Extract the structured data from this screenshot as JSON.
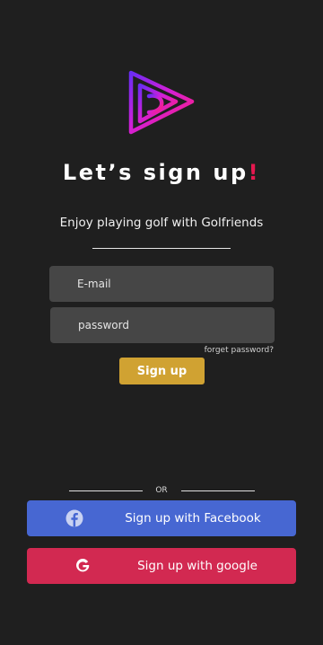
{
  "header": {
    "title": "Let’s sign up",
    "title_accent": "!",
    "subtitle": "Enjoy playing golf with Golfriends"
  },
  "form": {
    "email_placeholder": "E-mail",
    "password_placeholder": "password",
    "forgot_label": "forget password?",
    "signup_label": "Sign up"
  },
  "divider": {
    "or_label": "OR"
  },
  "social": {
    "facebook_label": "Sign up with Facebook",
    "google_label": "Sign up with google"
  },
  "colors": {
    "background": "#1f1f1f",
    "accent_red": "#e5184f",
    "signup_gold": "#d0a232",
    "facebook_blue": "#4767d2",
    "google_red": "#d22951",
    "input_gray": "#464646"
  },
  "icons": [
    "app-logo-icon",
    "facebook-icon",
    "google-icon"
  ]
}
